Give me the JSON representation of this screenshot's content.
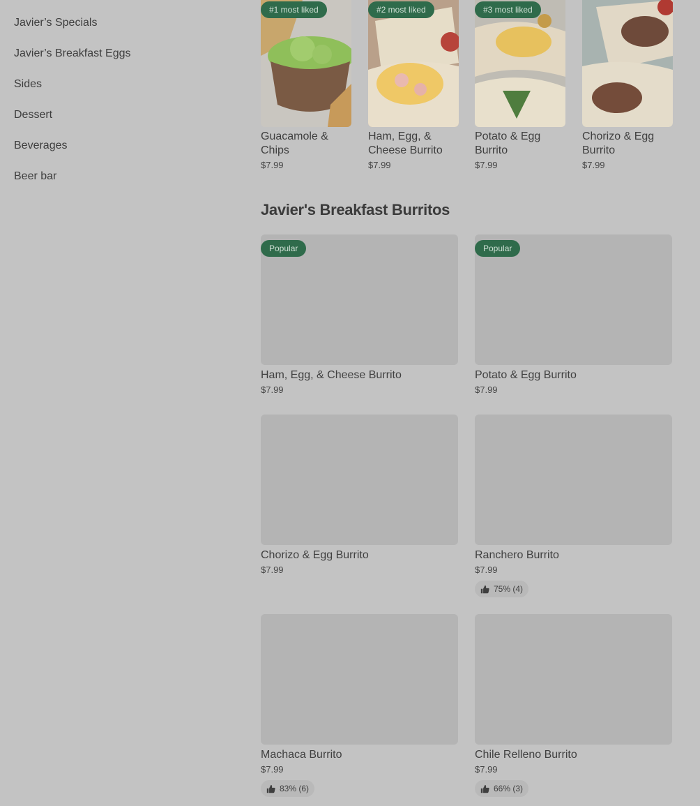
{
  "sidebar": {
    "items": [
      {
        "label": "Javier’s Specials"
      },
      {
        "label": "Javier’s Breakfast Eggs"
      },
      {
        "label": "Sides"
      },
      {
        "label": "Dessert"
      },
      {
        "label": "Beverages"
      },
      {
        "label": "Beer bar"
      }
    ]
  },
  "most_liked": [
    {
      "badge": "#1 most liked",
      "name": "Guacamole & Chips",
      "price": "$7.99"
    },
    {
      "badge": "#2 most liked",
      "name": "Ham, Egg, & Cheese Burrito",
      "price": "$7.99"
    },
    {
      "badge": "#3 most liked",
      "name": "Potato & Egg Burrito",
      "price": "$7.99"
    },
    {
      "badge": "",
      "name": "Chorizo & Egg Burrito",
      "price": "$7.99"
    }
  ],
  "section": {
    "title": "Javier's Breakfast Burritos",
    "items": [
      {
        "badge": "Popular",
        "name": "Ham, Egg, & Cheese Burrito",
        "price": "$7.99",
        "rating": ""
      },
      {
        "badge": "Popular",
        "name": "Potato & Egg Burrito",
        "price": "$7.99",
        "rating": ""
      },
      {
        "badge": "",
        "name": "Chorizo & Egg Burrito",
        "price": "$7.99",
        "rating": ""
      },
      {
        "badge": "",
        "name": "Ranchero Burrito",
        "price": "$7.99",
        "rating": "75% (4)"
      },
      {
        "badge": "",
        "name": "Machaca Burrito",
        "price": "$7.99",
        "rating": "83% (6)"
      },
      {
        "badge": "",
        "name": "Chile Relleno Burrito",
        "price": "$7.99",
        "rating": "66% (3)"
      }
    ]
  },
  "colors": {
    "page_bg": "#c3c3c3",
    "badge_bg": "#2f6b4b",
    "placeholder": "#b4b4b4"
  }
}
